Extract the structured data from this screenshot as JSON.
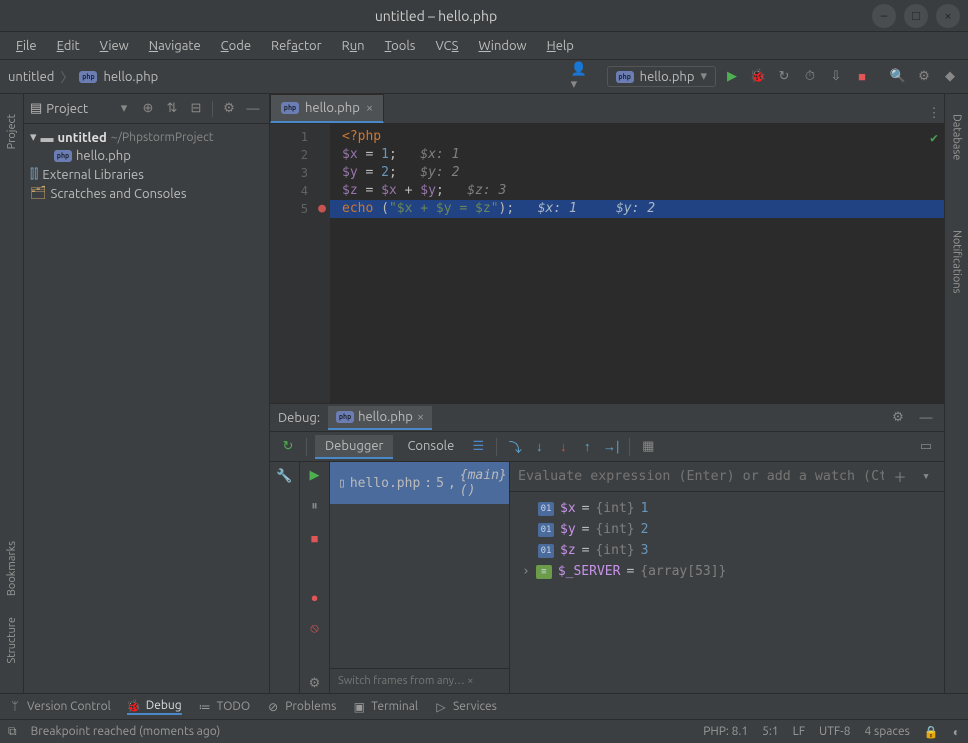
{
  "window": {
    "title": "untitled – hello.php"
  },
  "menus": [
    "File",
    "Edit",
    "View",
    "Navigate",
    "Code",
    "Refactor",
    "Run",
    "Tools",
    "VCS",
    "Window",
    "Help"
  ],
  "menu_underline_idx": [
    0,
    0,
    0,
    0,
    0,
    3,
    1,
    0,
    2,
    0,
    0
  ],
  "breadcrumb": {
    "root": "untitled",
    "file": "hello.php"
  },
  "run_config": {
    "label": "hello.php"
  },
  "project": {
    "panel_title": "Project",
    "root": {
      "name": "untitled",
      "path": "~/PhpstormProject"
    },
    "children": [
      {
        "name": "hello.php",
        "kind": "php"
      }
    ],
    "extras": [
      "External Libraries",
      "Scratches and Consoles"
    ]
  },
  "left_tabs": [
    "Project"
  ],
  "left_tabs_lower": [
    "Bookmarks",
    "Structure"
  ],
  "right_tabs": [
    "Database",
    "Notifications"
  ],
  "editor": {
    "tab": "hello.php",
    "lines": [
      {
        "n": 1,
        "segs": [
          [
            "kw",
            "<?php"
          ]
        ]
      },
      {
        "n": 2,
        "segs": [
          [
            "var",
            "$x"
          ],
          [
            "p",
            " = "
          ],
          [
            "num",
            "1"
          ],
          [
            "p",
            ";   "
          ],
          [
            "comment",
            "$x: 1"
          ]
        ]
      },
      {
        "n": 3,
        "segs": [
          [
            "var",
            "$y"
          ],
          [
            "p",
            " = "
          ],
          [
            "num",
            "2"
          ],
          [
            "p",
            ";   "
          ],
          [
            "comment",
            "$y: 2"
          ]
        ]
      },
      {
        "n": 4,
        "segs": [
          [
            "var",
            "$z"
          ],
          [
            "p",
            " = "
          ],
          [
            "var",
            "$x"
          ],
          [
            "p",
            " + "
          ],
          [
            "var",
            "$y"
          ],
          [
            "p",
            ";   "
          ],
          [
            "comment",
            "$z: 3"
          ]
        ]
      },
      {
        "n": 5,
        "hl": true,
        "bp": true,
        "segs": [
          [
            "kw",
            "echo"
          ],
          [
            "p",
            " ("
          ],
          [
            "str",
            "\"$x + $y = $z\""
          ],
          [
            "p",
            ");   "
          ],
          [
            "hint",
            "$x: 1     $y: 2"
          ]
        ]
      }
    ]
  },
  "debug": {
    "title": "Debug:",
    "session": "hello.php",
    "tabs": {
      "debugger": "Debugger",
      "console": "Console"
    },
    "frame": {
      "file": "hello.php",
      "line": "5",
      "fn": "{main}()"
    },
    "eval_placeholder": "Evaluate expression (Enter) or add a watch (Ctrl+Shift+Enter)",
    "vars": [
      {
        "name": "$x",
        "type": "{int}",
        "value": "1"
      },
      {
        "name": "$y",
        "type": "{int}",
        "value": "2"
      },
      {
        "name": "$z",
        "type": "{int}",
        "value": "3"
      },
      {
        "name": "$_SERVER",
        "type": "{array[53]}",
        "value": "",
        "expandable": true
      }
    ],
    "frames_hint": "Switch frames from any… ×"
  },
  "bottom_tools": [
    {
      "icon": "branch",
      "label": "Version Control"
    },
    {
      "icon": "bug",
      "label": "Debug",
      "active": true
    },
    {
      "icon": "list",
      "label": "TODO"
    },
    {
      "icon": "warn",
      "label": "Problems"
    },
    {
      "icon": "term",
      "label": "Terminal"
    },
    {
      "icon": "play",
      "label": "Services"
    }
  ],
  "status": {
    "message": "Breakpoint reached (moments ago)",
    "items": [
      "PHP: 8.1",
      "5:1",
      "LF",
      "UTF-8",
      "4 spaces"
    ]
  }
}
